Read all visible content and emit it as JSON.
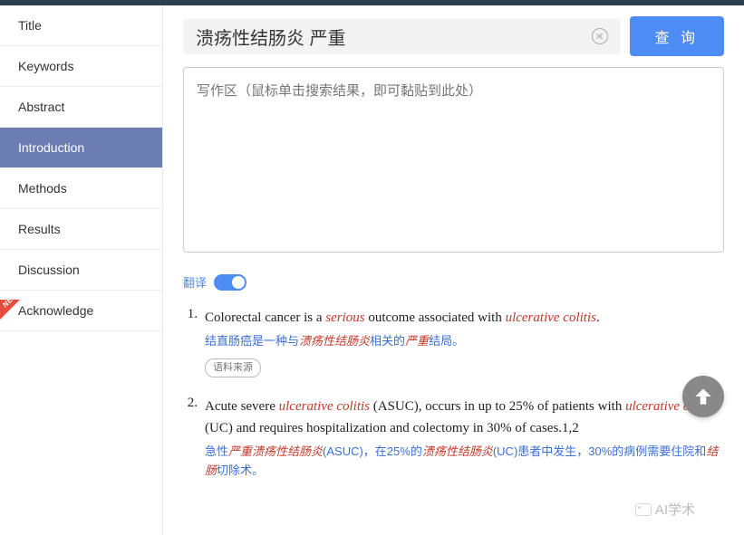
{
  "sidebar": {
    "items": [
      {
        "label": "Title"
      },
      {
        "label": "Keywords"
      },
      {
        "label": "Abstract"
      },
      {
        "label": "Introduction"
      },
      {
        "label": "Methods"
      },
      {
        "label": "Results"
      },
      {
        "label": "Discussion"
      },
      {
        "label": "Acknowledge"
      }
    ],
    "active_index": 3,
    "new_badge": "NEW"
  },
  "search": {
    "value": "溃疡性结肠炎 严重",
    "clear_symbol": "✕",
    "query_label": "查 询"
  },
  "writing": {
    "placeholder": "写作区（鼠标单击搜索结果，即可黏贴到此处）"
  },
  "toggle": {
    "label": "翻译",
    "on": true
  },
  "results": [
    {
      "num": "1.",
      "en_pre": "Colorectal cancer is a ",
      "en_hl1": "serious",
      "en_mid": " outcome associated with ",
      "en_hl2": "ulcerative colitis",
      "en_post": ".",
      "zh_pre": "结直肠癌是一种与",
      "zh_hl1": "溃疡性结肠炎",
      "zh_mid": "相关的",
      "zh_hl2": "严重",
      "zh_post": "结局。",
      "source_label": "语料来源"
    },
    {
      "num": "2.",
      "en_pre": "Acute severe ",
      "en_hl1": "ulcerative colitis",
      "en_mid1": " (ASUC), occurs in up to 25% of patients with ",
      "en_hl2": "ulcerative colitis",
      "en_mid2": " (UC) and requires hospitalization and colectomy in 30% of cases.1,2",
      "zh_p1": "急性",
      "zh_hl1": "严重溃疡性结肠炎",
      "zh_p2": "(ASUC)，在25%的",
      "zh_hl2": "溃疡性结肠炎",
      "zh_p3": "(UC)患者中发生，30%的病例需要住院和",
      "zh_hl3": "结肠",
      "zh_p4": "切除术。"
    }
  ],
  "watermark": "AI学术"
}
